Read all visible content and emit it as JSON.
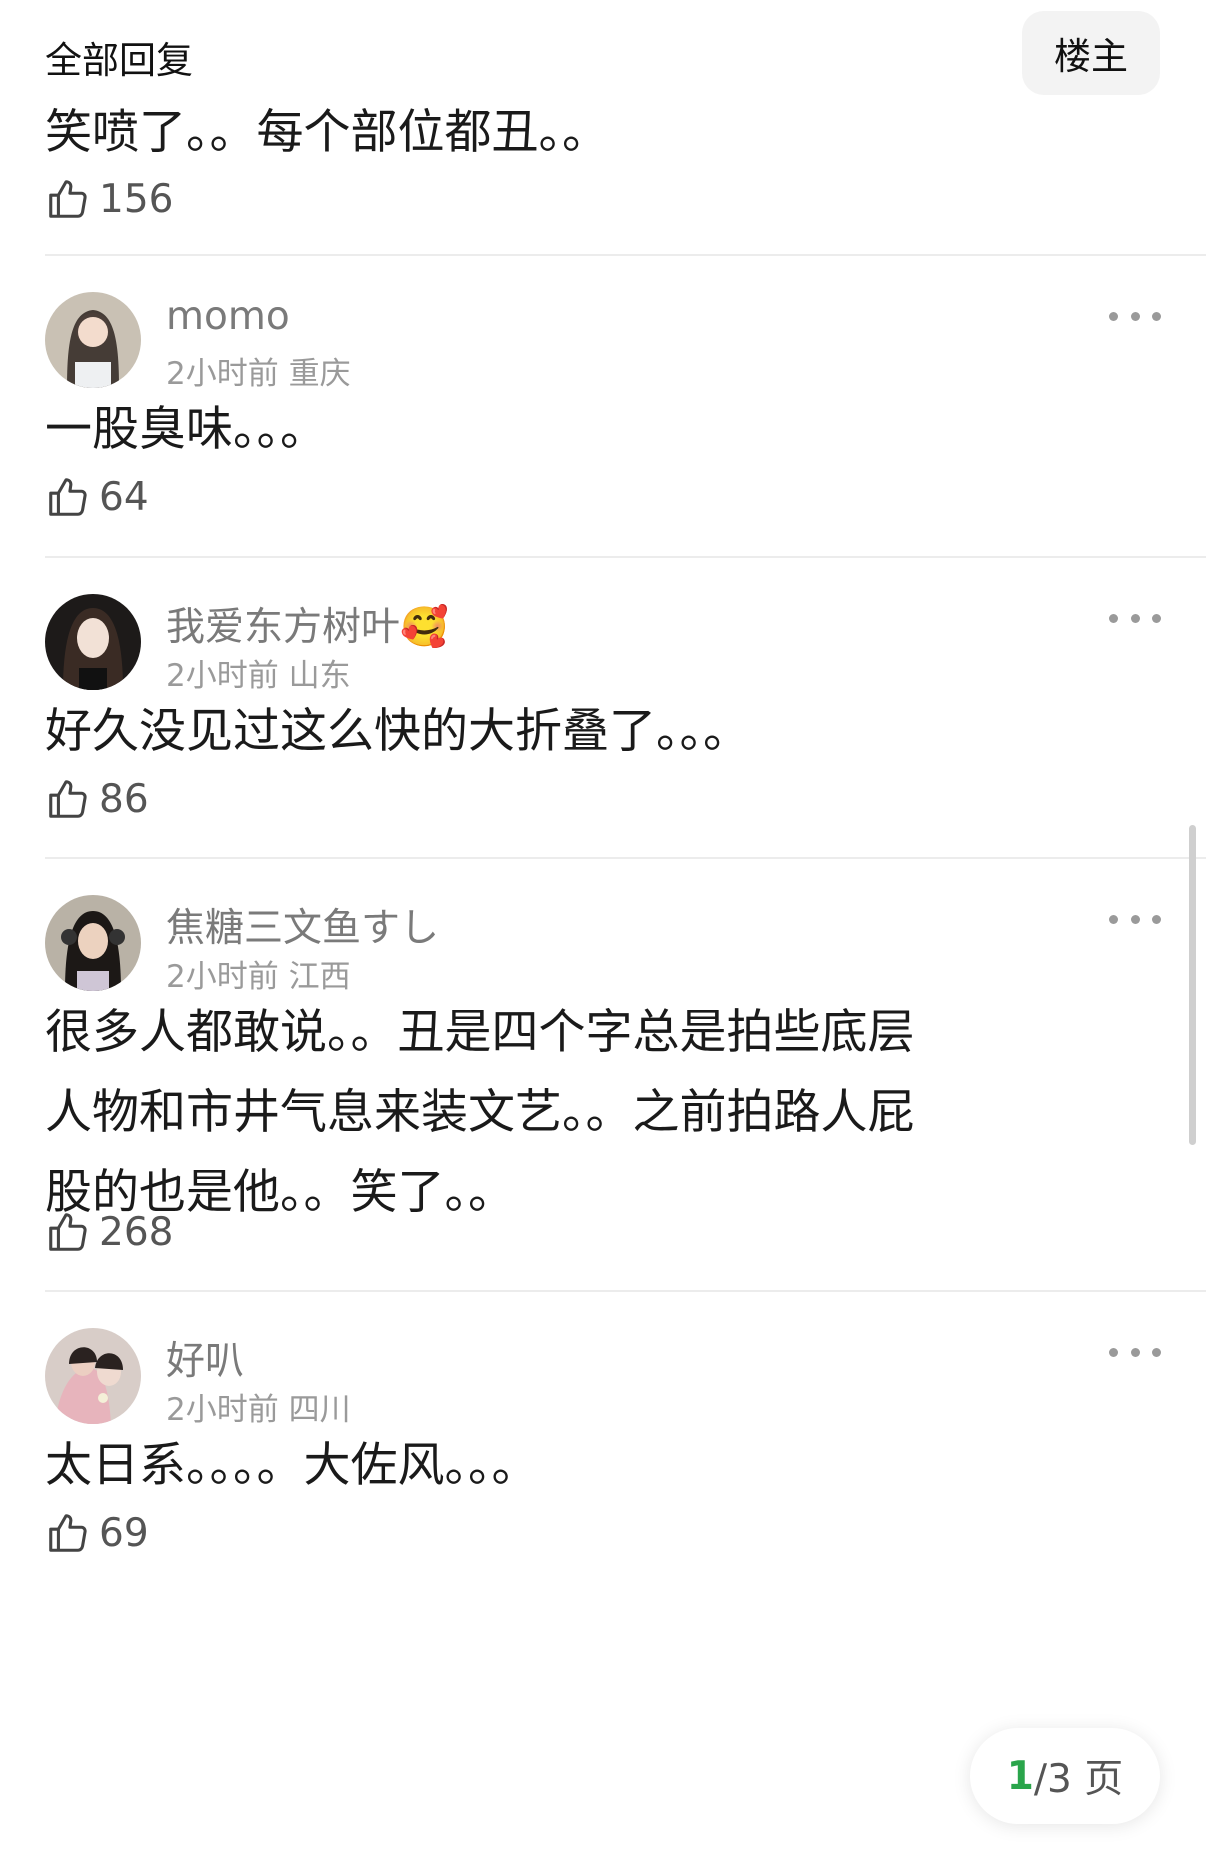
{
  "header": {
    "title": "全部回复",
    "op_button": "楼主"
  },
  "top_reply": {
    "content": "笑喷了。。每个部位都丑。。",
    "likes": "156"
  },
  "replies": [
    {
      "username": "momo",
      "time": "2小时前",
      "location": "重庆",
      "content": "一股臭味。。。",
      "likes": "64"
    },
    {
      "username": "我爱东方树叶🥰",
      "time": "2小时前",
      "location": "山东",
      "content": "好久没见过这么快的大折叠了。。。",
      "likes": "86"
    },
    {
      "username": "焦糖三文鱼すし",
      "time": "2小时前",
      "location": "江西",
      "content": "很多人都敢说。。丑是四个字总是拍些底层人物和市井气息来装文艺。。之前拍路人屁股的也是他。。笑了。。",
      "likes": "268"
    },
    {
      "username": "好叭",
      "time": "2小时前",
      "location": "四川",
      "content": "太日系。。。。大佐风。。。",
      "likes": "69"
    }
  ],
  "pager": {
    "current": "1",
    "total_text": "/3 页"
  },
  "colors": {
    "accent": "#2aa54b",
    "divider": "#ececec",
    "meta": "#9a9a9a"
  },
  "icons": [
    "thumbs-up-icon",
    "more-icon"
  ]
}
